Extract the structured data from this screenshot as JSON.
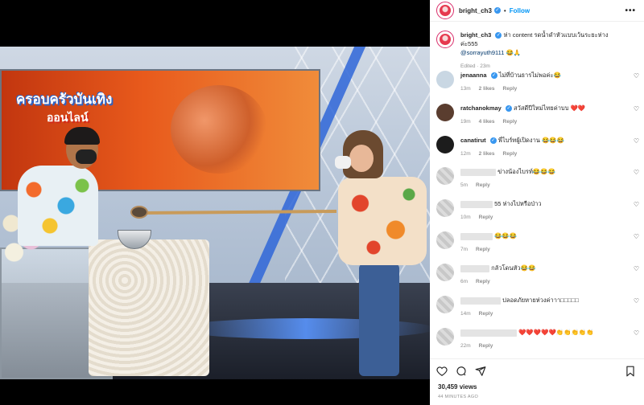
{
  "post": {
    "username": "bright_ch3",
    "follow_label": "Follow",
    "more_label": "•••",
    "caption_text": "ห่า content รดน้ำดำหัวแบบเว้นระยะห่างค่ะ555",
    "caption_mention": "@sorrayuth9111",
    "caption_emoji": "😂🙏",
    "edited": "Edited · 23m"
  },
  "video": {
    "screen_title": "ครอบครัวบันเทิง",
    "screen_subtitle": "ออนไลน์"
  },
  "comments": [
    {
      "username": "jenaanna",
      "text": "ไม่ที่บ้านธารไม่พอค่ะ😂",
      "time": "13m",
      "likes": "2 likes",
      "reply": "Reply",
      "verified": true
    },
    {
      "username": "ratchanokmay",
      "text": "สวัสดีปีใหม่ไทยค่าบบ",
      "hearts": "❤️❤️",
      "time": "19m",
      "likes": "4 likes",
      "reply": "Reply",
      "verified": true
    },
    {
      "username": "canatirut",
      "text": "พี่ไบร์ทผู้เปิดงาน 😂😂😂",
      "time": "12m",
      "likes": "2 likes",
      "reply": "Reply",
      "verified": true
    },
    {
      "username": "",
      "text": "ข่างน้องไบรท์😂😂😂",
      "time": "5m",
      "reply": "Reply"
    },
    {
      "username": "",
      "text": "55 ห่างไปหรือป่าว",
      "time": "10m",
      "reply": "Reply"
    },
    {
      "username": "",
      "text": "😂😂😂",
      "time": "7m",
      "reply": "Reply"
    },
    {
      "username": "",
      "text": "กลัวโดนหัว😂😂",
      "time": "6m",
      "reply": "Reply"
    },
    {
      "username": "",
      "text": "ปลอดภัยหายห่วงค่าาา□□□□□",
      "time": "14m",
      "reply": "Reply"
    },
    {
      "username": "",
      "text": "❤️❤️❤️❤️❤️👏👏👏👏👏",
      "time": "22m",
      "reply": "Reply"
    }
  ],
  "footer": {
    "views": "30,459 views",
    "ago": "44 MINUTES AGO"
  }
}
